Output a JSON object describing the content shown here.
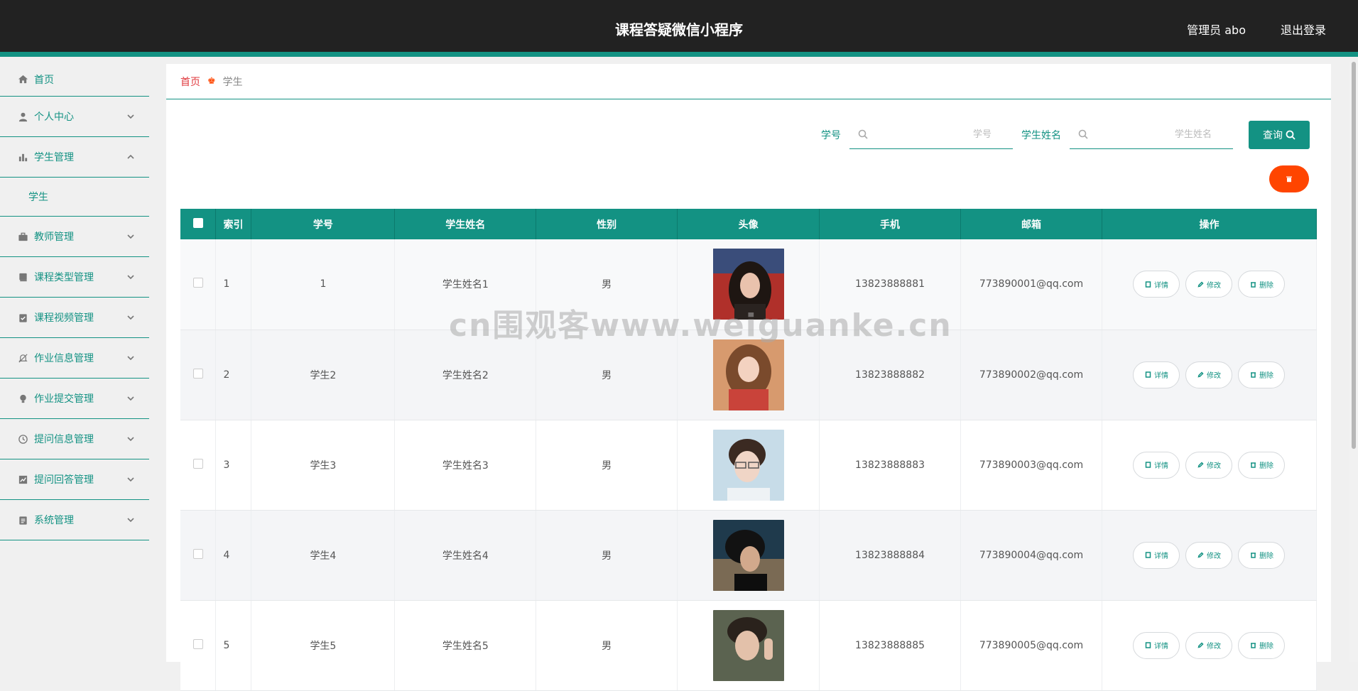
{
  "header": {
    "title": "课程答疑微信小程序",
    "user": "管理员 abo",
    "logout": "退出登录"
  },
  "sidebar": {
    "items": [
      {
        "label": "首页",
        "icon": "home-icon"
      },
      {
        "label": "个人中心",
        "icon": "user-icon"
      },
      {
        "label": "学生管理",
        "icon": "bar-chart-icon",
        "expanded": true,
        "sub": "学生"
      },
      {
        "label": "教师管理",
        "icon": "briefcase-icon"
      },
      {
        "label": "课程类型管理",
        "icon": "book-icon"
      },
      {
        "label": "课程视频管理",
        "icon": "clipboard-check-icon"
      },
      {
        "label": "作业信息管理",
        "icon": "bell-off-icon"
      },
      {
        "label": "作业提交管理",
        "icon": "bulb-icon"
      },
      {
        "label": "提问信息管理",
        "icon": "clock-icon"
      },
      {
        "label": "提问回答管理",
        "icon": "line-chart-icon"
      },
      {
        "label": "系统管理",
        "icon": "clipboard-icon"
      }
    ]
  },
  "breadcrumb": {
    "home": "首页",
    "current": "学生"
  },
  "search": {
    "label1": "学号",
    "placeholder1": "学号",
    "label2": "学生姓名",
    "placeholder2": "学生姓名",
    "button": "查询"
  },
  "table": {
    "headers": [
      "索引",
      "学号",
      "学生姓名",
      "性别",
      "头像",
      "手机",
      "邮箱",
      "操作"
    ],
    "rows": [
      {
        "index": "1",
        "id": "1",
        "name": "学生姓名1",
        "gender": "男",
        "phone": "13823888881",
        "email": "773890001@qq.com"
      },
      {
        "index": "2",
        "id": "学生2",
        "name": "学生姓名2",
        "gender": "男",
        "phone": "13823888882",
        "email": "773890002@qq.com"
      },
      {
        "index": "3",
        "id": "学生3",
        "name": "学生姓名3",
        "gender": "男",
        "phone": "13823888883",
        "email": "773890003@qq.com"
      },
      {
        "index": "4",
        "id": "学生4",
        "name": "学生姓名4",
        "gender": "男",
        "phone": "13823888884",
        "email": "773890004@qq.com"
      },
      {
        "index": "5",
        "id": "学生5",
        "name": "学生姓名5",
        "gender": "男",
        "phone": "13823888885",
        "email": "773890005@qq.com"
      }
    ],
    "actions": {
      "detail": "详情",
      "edit": "修改",
      "delete": "删除"
    }
  },
  "watermark": "cn围观客www.weiguanke.cn",
  "colors": {
    "accent": "#139283",
    "danger": "#ff4500",
    "header_bg": "#222222"
  }
}
